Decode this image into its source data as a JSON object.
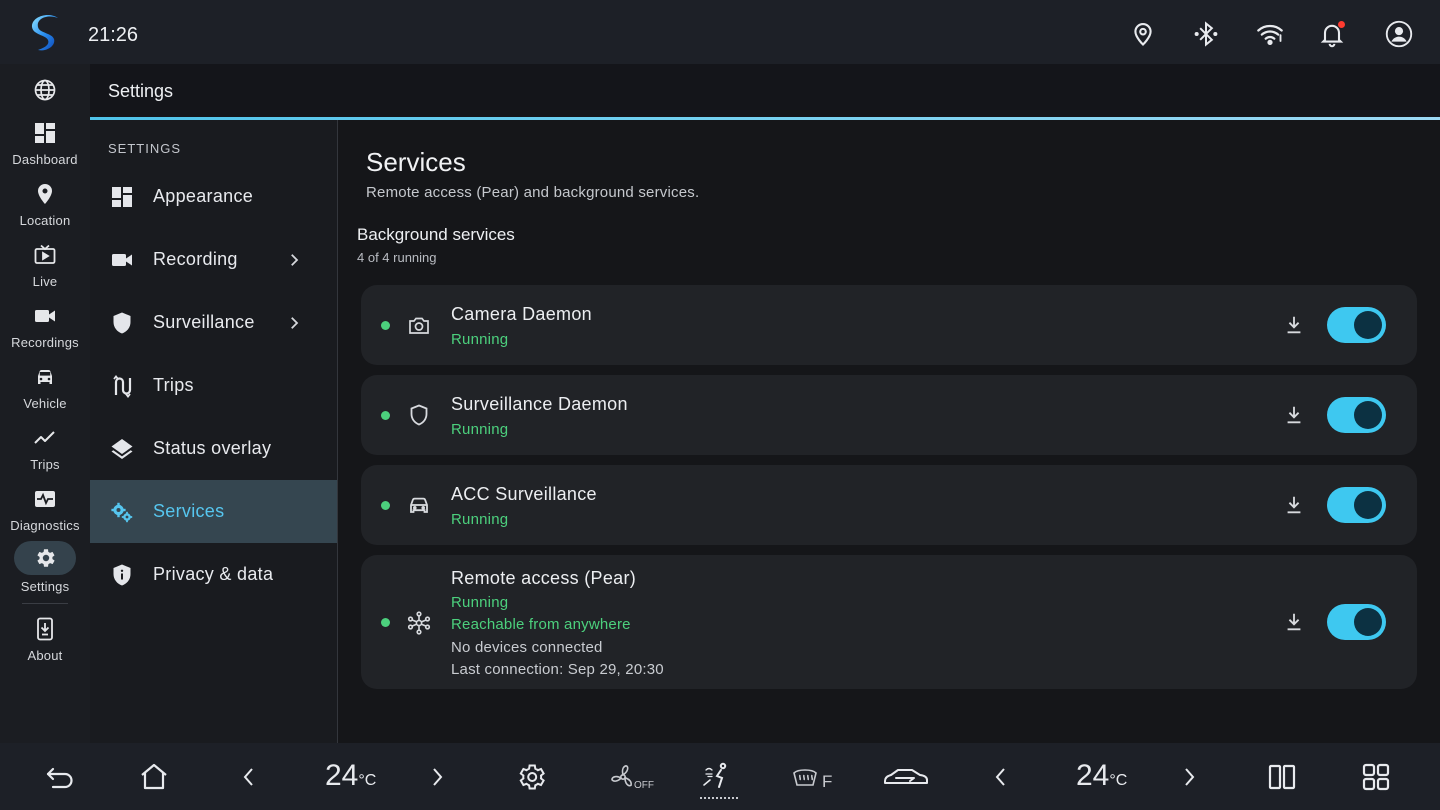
{
  "status_bar": {
    "time": "21:26",
    "icons": [
      "location-pin-icon",
      "bluetooth-icon",
      "wifi-icon",
      "notifications-icon",
      "account-icon"
    ],
    "notification_badge_color": "#ff3b30"
  },
  "rail": {
    "items": [
      {
        "id": "web",
        "label": "",
        "icon": "globe-icon"
      },
      {
        "id": "dashboard",
        "label": "Dashboard",
        "icon": "dashboard-icon"
      },
      {
        "id": "location",
        "label": "Location",
        "icon": "location-pin-icon"
      },
      {
        "id": "live",
        "label": "Live",
        "icon": "live-tv-icon"
      },
      {
        "id": "recordings",
        "label": "Recordings",
        "icon": "videocam-icon"
      },
      {
        "id": "vehicle",
        "label": "Vehicle",
        "icon": "car-icon"
      },
      {
        "id": "trips",
        "label": "Trips",
        "icon": "trending-line-icon"
      },
      {
        "id": "diagnostics",
        "label": "Diagnostics",
        "icon": "monitor-heart-icon"
      },
      {
        "id": "settings",
        "label": "Settings",
        "icon": "gear-icon",
        "active": true
      },
      {
        "id": "about",
        "label": "About",
        "icon": "install-mobile-icon"
      }
    ]
  },
  "header": {
    "title": "Settings"
  },
  "subnav": {
    "heading": "SETTINGS",
    "items": [
      {
        "label": "Appearance",
        "icon": "dashboard-icon"
      },
      {
        "label": "Recording",
        "icon": "videocam-icon",
        "has_chevron": true
      },
      {
        "label": "Surveillance",
        "icon": "shield-icon",
        "has_chevron": true
      },
      {
        "label": "Trips",
        "icon": "route-icon"
      },
      {
        "label": "Status overlay",
        "icon": "layers-icon"
      },
      {
        "label": "Services",
        "icon": "gears-icon",
        "active": true
      },
      {
        "label": "Privacy & data",
        "icon": "privacy-shield-icon"
      }
    ]
  },
  "main": {
    "title": "Services",
    "subtitle": "Remote access (Pear) and background services.",
    "section_title": "Background services",
    "section_sub": "4 of 4 running",
    "services": [
      {
        "name": "Camera Daemon",
        "status": "Running",
        "icon": "camera-icon",
        "enabled": true
      },
      {
        "name": "Surveillance Daemon",
        "status": "Running",
        "icon": "shield-outline-icon",
        "enabled": true
      },
      {
        "name": "ACC Surveillance",
        "status": "Running",
        "icon": "car-outline-icon",
        "enabled": true
      },
      {
        "name": "Remote access (Pear)",
        "status": "Running",
        "icon": "hub-icon",
        "enabled": true,
        "reachability": "Reachable from anywhere",
        "devices": "No devices connected",
        "last_connection": "Last connection: Sep 29, 20:30"
      }
    ],
    "status_color": "#4cd07d",
    "accent_color": "#3ec8f0"
  },
  "bottom_bar": {
    "left_temp": "24",
    "right_temp": "24",
    "temp_unit": "°C",
    "fan_state": "OFF",
    "defrost_label": "F",
    "icons": [
      "back-icon",
      "home-icon",
      "chevron-left-icon",
      "chevron-right-icon",
      "gear-icon",
      "fan-icon",
      "airflow-icon",
      "defrost-icon",
      "car-recirculation-icon",
      "chevron-left-icon",
      "chevron-right-icon",
      "split-screen-icon",
      "apps-grid-icon"
    ]
  }
}
